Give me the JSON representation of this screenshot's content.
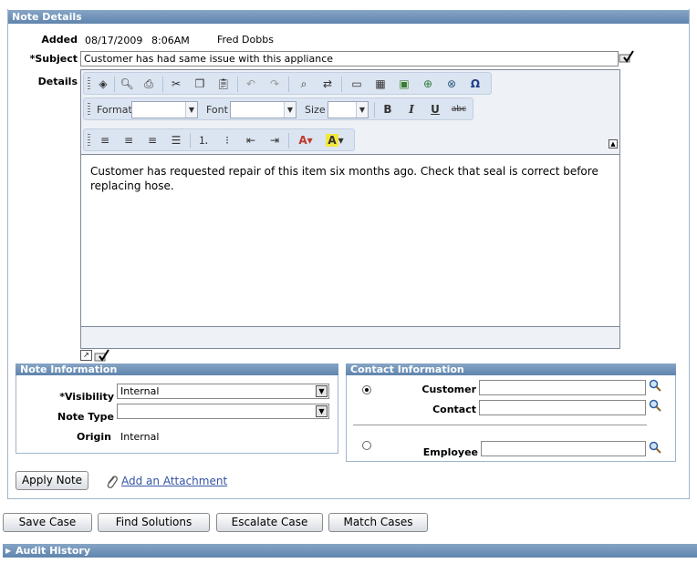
{
  "note_details": {
    "header": "Note Details",
    "added_label": "Added",
    "added_date": "08/17/2009",
    "added_time": "8:06AM",
    "added_by": "Fred Dobbs",
    "subject_label": "*Subject",
    "subject_value": "Customer has had same issue with this appliance",
    "details_label": "Details",
    "toolbar": {
      "format_label": "Format",
      "font_label": "Font",
      "size_label": "Size",
      "bold": "B",
      "italic": "I",
      "underline": "U",
      "strike": "abc",
      "special_char": "Ω"
    },
    "details_text": "Customer has requested repair of this item six months ago. Check that seal is correct before replacing hose."
  },
  "note_information": {
    "header": "Note Information",
    "visibility_label": "*Visibility",
    "visibility_value": "Internal",
    "note_type_label": "Note Type",
    "note_type_value": "",
    "origin_label": "Origin",
    "origin_value": "Internal"
  },
  "contact_information": {
    "header": "Contact Information",
    "customer_label": "Customer",
    "contact_label": "Contact",
    "employee_label": "Employee"
  },
  "actions": {
    "apply_note": "Apply Note",
    "add_attachment": "Add an Attachment"
  },
  "bottom_buttons": {
    "save_case": "Save Case",
    "find_solutions": "Find Solutions",
    "escalate_case": "Escalate Case",
    "match_cases": "Match Cases"
  },
  "audit_history": {
    "header": "Audit History"
  },
  "colors": {
    "header_blue": "#5f84ad",
    "link_blue": "#3454a4"
  }
}
